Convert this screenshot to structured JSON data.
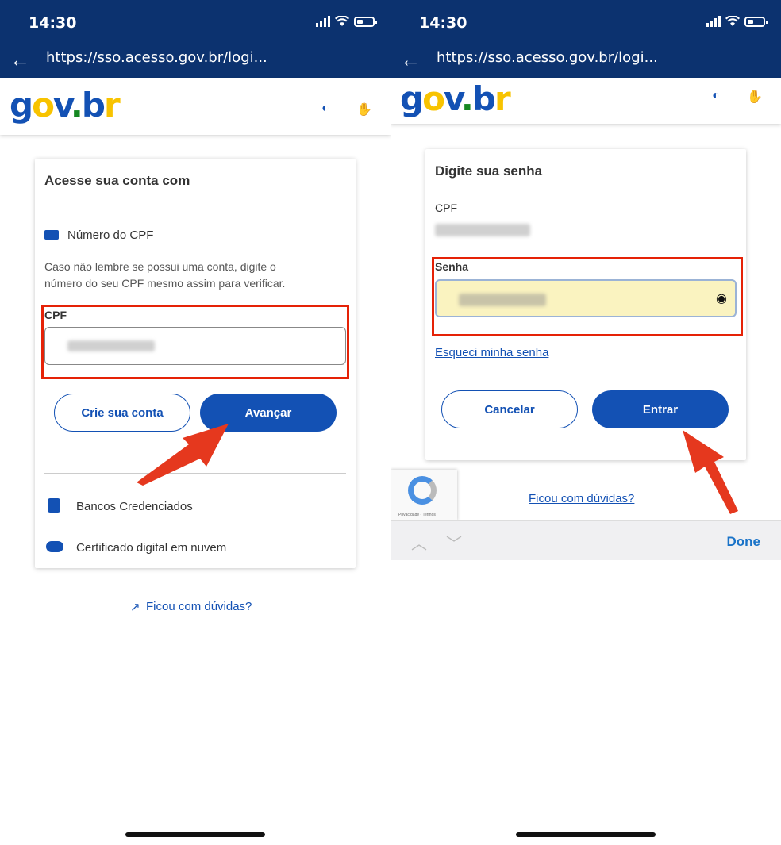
{
  "left": {
    "status_time": "14:30",
    "url": "https://sso.acesso.gov.br/logi...",
    "card_title": "Acesse sua conta com",
    "option_cpf": "Número do CPF",
    "help_text_line1": "Caso não lembre se possui uma conta, digite o",
    "help_text_line2": "número do seu CPF mesmo assim para verificar.",
    "cpf_label": "CPF",
    "create_account_label": "Crie sua conta",
    "next_label": "Avançar",
    "banks_label": "Bancos Credenciados",
    "cert_label": "Certificado digital em nuvem",
    "help_link": "Ficou com dúvidas?"
  },
  "right": {
    "status_time": "14:30",
    "url": "https://sso.acesso.gov.br/logi...",
    "card_title": "Digite sua senha",
    "cpf_label": "CPF",
    "password_label": "Senha",
    "forgot_label": "Esqueci minha senha",
    "cancel_label": "Cancelar",
    "enter_label": "Entrar",
    "help_link": "Ficou com dúvidas?",
    "recaptcha_text": "Privacidade - Termos",
    "keyboard_done": "Done"
  },
  "logo": {
    "g": "g",
    "o": "o",
    "v": "v",
    "dot": ".",
    "b": "b",
    "r": "r"
  },
  "colors": {
    "primary": "#1351b4",
    "header_bg": "#0c326f",
    "highlight": "#e52207",
    "autofill": "#faf3c0"
  }
}
